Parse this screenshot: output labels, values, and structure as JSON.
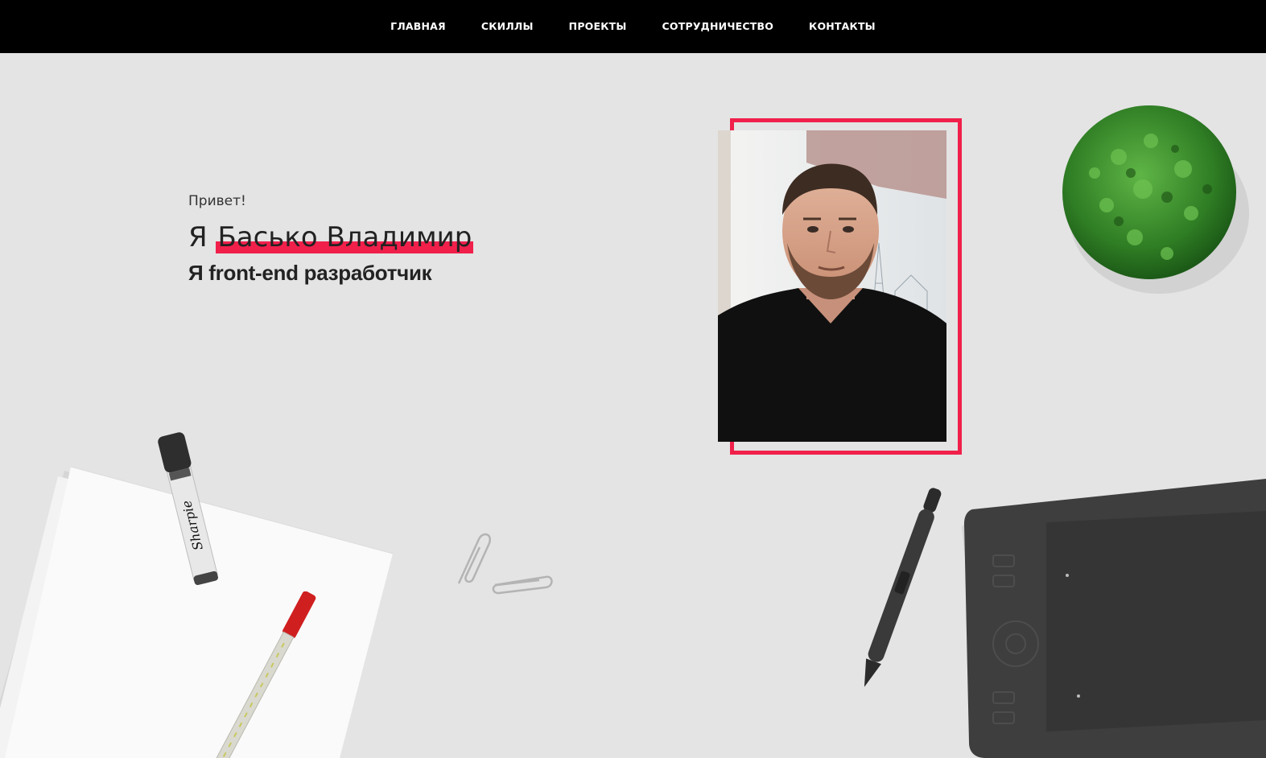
{
  "nav": {
    "items": [
      {
        "label": "ГЛАВНАЯ"
      },
      {
        "label": "СКИЛЛЫ"
      },
      {
        "label": "ПРОЕКТЫ"
      },
      {
        "label": "СОТРУДНИЧЕСТВО"
      },
      {
        "label": "КОНТАКТЫ"
      }
    ]
  },
  "hero": {
    "greeting": "Привет!",
    "prefix": "Я",
    "name": "Басько Владимир",
    "role": "Я front-end разработчик"
  },
  "marker": {
    "brand": "Sharpie"
  },
  "colors": {
    "accent": "#f0204b",
    "nav_bg": "#000000",
    "page_bg": "#e4e4e4"
  }
}
